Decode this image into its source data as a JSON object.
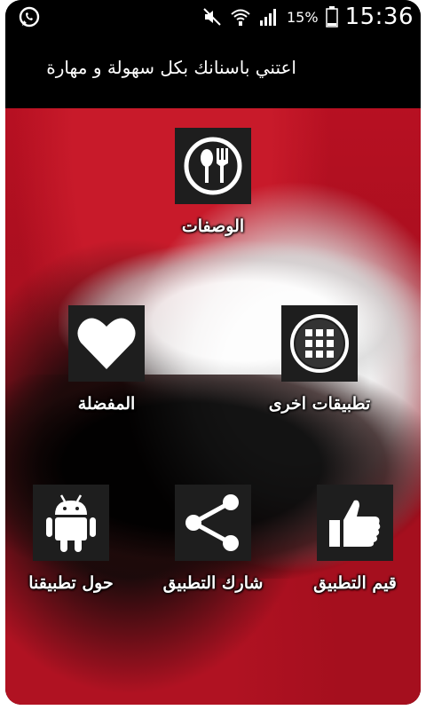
{
  "status_bar": {
    "left_icon": "whatsapp-icon",
    "battery_percent": "15%",
    "time": "15:36"
  },
  "header": {
    "title": "اعتني باسنانك بكل سهولة و مهارة"
  },
  "menu": {
    "recipes": {
      "label": "الوصفات",
      "icon": "fork-spoon-icon"
    },
    "other_apps": {
      "label": "تطبيقات اخرى",
      "icon": "apps-grid-icon"
    },
    "favorites": {
      "label": "المفضلة",
      "icon": "heart-icon"
    },
    "rate_app": {
      "label": "قيم التطبيق",
      "icon": "thumbs-up-icon"
    },
    "share_app": {
      "label": "شارك التطبيق",
      "icon": "share-icon"
    },
    "about": {
      "label": "حول تطبيقنا",
      "icon": "android-icon"
    }
  }
}
